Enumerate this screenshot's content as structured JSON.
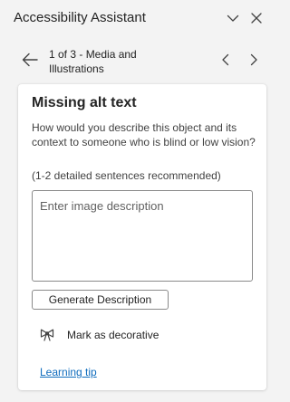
{
  "pane": {
    "title": "Accessibility Assistant"
  },
  "nav": {
    "position_text": "1 of 3 - Media and Illustrations"
  },
  "card": {
    "title": "Missing alt text",
    "description": "How would you describe this object and its context to someone who is blind or low vision?",
    "hint": "(1-2 detailed sentences recommended)",
    "input_value": "",
    "input_placeholder": "Enter image description",
    "generate_label": "Generate Description",
    "decorative_label": "Mark as decorative",
    "learning_tip": "Learning tip"
  },
  "colors": {
    "pane_background": "#f3f3f3",
    "card_background": "#ffffff",
    "link": "#0f6cbd",
    "text": "#242424"
  },
  "icons": {
    "collapse": "chevron-down-icon",
    "close": "close-icon",
    "back": "arrow-left-icon",
    "previous": "chevron-left-icon",
    "next": "chevron-right-icon",
    "decorative": "ribbon-icon"
  }
}
